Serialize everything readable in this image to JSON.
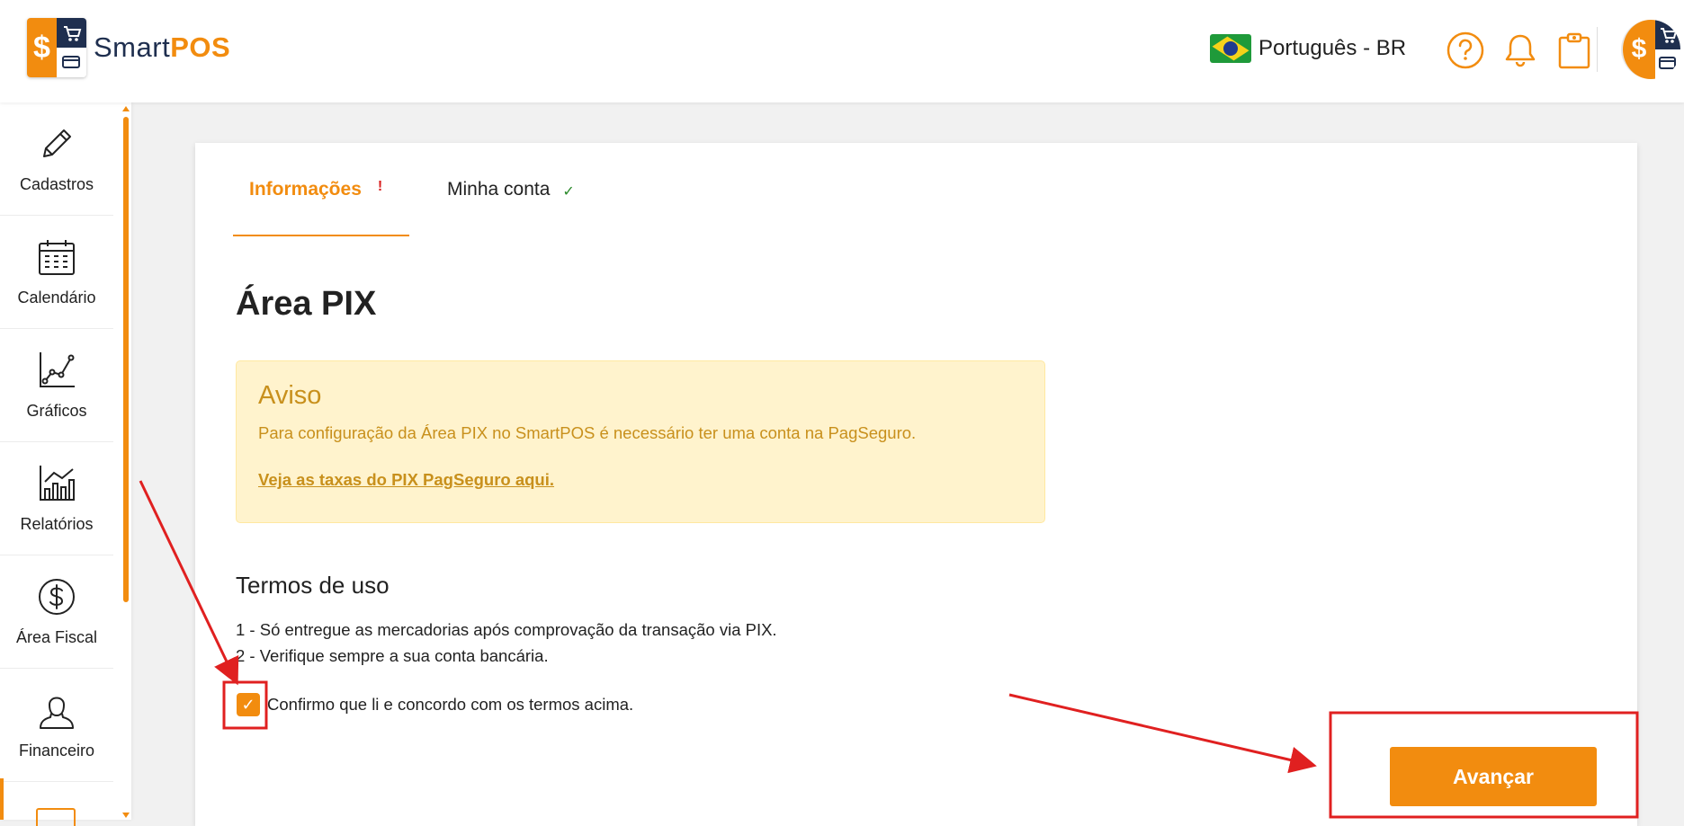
{
  "header": {
    "logo_text_plain": "Smart",
    "logo_text_bold": "POS",
    "language": "Português - BR",
    "icons": [
      "help-icon",
      "bell-icon",
      "clipboard-icon"
    ]
  },
  "sidebar": {
    "items": [
      {
        "label": "Cadastros",
        "icon": "pencil-icon"
      },
      {
        "label": "Calendário",
        "icon": "calendar-icon"
      },
      {
        "label": "Gráficos",
        "icon": "line-chart-icon"
      },
      {
        "label": "Relatórios",
        "icon": "bar-chart-icon"
      },
      {
        "label": "Área Fiscal",
        "icon": "dollar-icon"
      },
      {
        "label": "Financeiro",
        "icon": "user-icon"
      }
    ]
  },
  "tabs": [
    {
      "label": "Informações",
      "status": "!"
    },
    {
      "label": "Minha conta",
      "status": "✓"
    }
  ],
  "page": {
    "title": "Área PIX",
    "alert": {
      "title": "Aviso",
      "text": "Para configuração da Área PIX no SmartPOS é necessário ter uma conta na PagSeguro.",
      "link": "Veja as taxas do PIX PagSeguro aqui."
    },
    "terms": {
      "title": "Termos de uso",
      "lines": [
        "1 - Só entregue as mercadorias após comprovação da transação via PIX.",
        "2 - Verifique sempre a sua conta bancária."
      ],
      "confirm_label": "Confirmo que li e concordo com os termos acima.",
      "confirm_checked": true
    },
    "advance_label": "Avançar"
  },
  "colors": {
    "accent": "#f28c0f",
    "navy": "#1f2f4f",
    "alert_bg": "#fff3cd",
    "alert_text": "#c8901c",
    "annotation": "#e02020"
  }
}
